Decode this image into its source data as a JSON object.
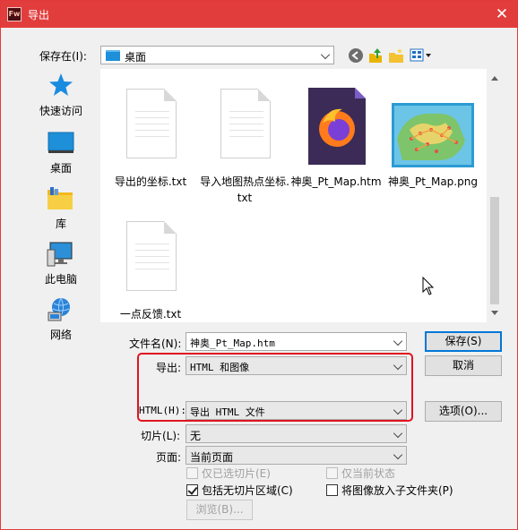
{
  "window": {
    "app_icon": "Fw",
    "title": "导出",
    "close": "✕"
  },
  "save_in": {
    "label": "保存在(I):",
    "value": "桌面"
  },
  "places": [
    {
      "label": "快速访问",
      "icon": "star-icon"
    },
    {
      "label": "桌面",
      "icon": "desktop-icon"
    },
    {
      "label": "库",
      "icon": "library-icon"
    },
    {
      "label": "此电脑",
      "icon": "computer-icon"
    },
    {
      "label": "网络",
      "icon": "network-icon"
    }
  ],
  "files": [
    {
      "name": "导出的坐标.txt",
      "type": "text"
    },
    {
      "name": "导入地图热点坐标.txt",
      "type": "text"
    },
    {
      "name": "神奥_Pt_Map.htm",
      "type": "firefox"
    },
    {
      "name": "神奥_Pt_Map.png",
      "type": "image"
    },
    {
      "name": "一点反馈.txt",
      "type": "text"
    }
  ],
  "form": {
    "filename_label": "文件名(N):",
    "filename_value": "神奥_Pt_Map.htm",
    "export_label": "导出:",
    "export_value": "HTML 和图像",
    "html_label": "HTML(H):",
    "html_value": "导出 HTML 文件",
    "slices_label": "切片(L):",
    "slices_value": "无",
    "page_label": "页面:",
    "page_value": "当前页面"
  },
  "buttons": {
    "save": "保存(S)",
    "cancel": "取消",
    "options": "选项(O)...",
    "browse": "浏览(B)..."
  },
  "checkboxes": {
    "selected_slices_only": {
      "label": "仅已选切片(E)",
      "checked": false,
      "enabled": false
    },
    "current_state_only": {
      "label": "仅当前状态",
      "checked": false,
      "enabled": false
    },
    "include_no_slice_area": {
      "label": "包括无切片区域(C)",
      "checked": true,
      "enabled": true
    },
    "put_images_in_subfolder": {
      "label": "将图像放入子文件夹(P)",
      "checked": false,
      "enabled": true
    }
  },
  "colors": {
    "titlebar": "#e23d3d",
    "highlight_box": "#e0141e",
    "accent": "#0078d7"
  }
}
